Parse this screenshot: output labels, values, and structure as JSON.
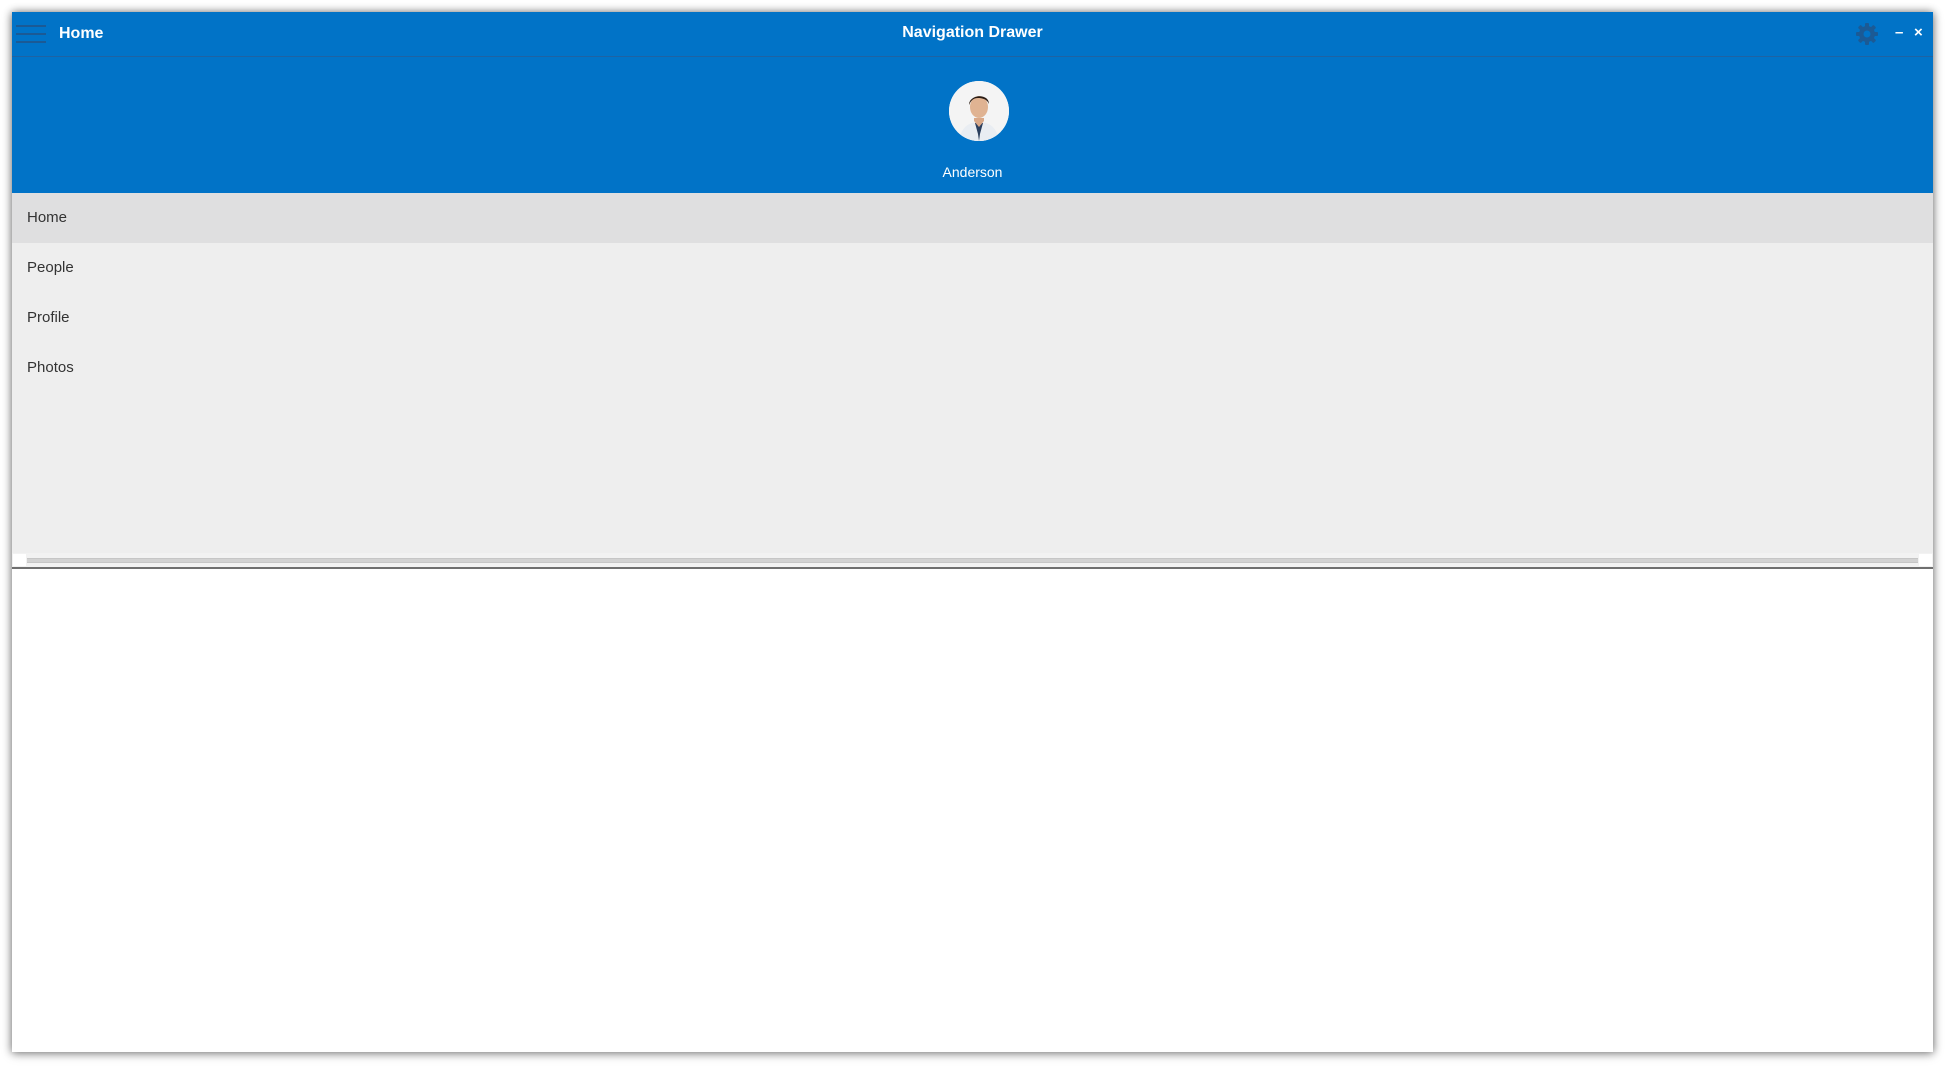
{
  "window": {
    "page_title": "Home",
    "app_title": "Navigation Drawer",
    "minimize_label": "–",
    "close_label": "×",
    "icons": {
      "menu": "hamburger-icon",
      "settings": "gear-icon"
    },
    "accent_color": "#0173c7"
  },
  "drawer": {
    "user_name": "Anderson",
    "menu_items": [
      {
        "label": "Home",
        "selected": true
      },
      {
        "label": "People",
        "selected": false
      },
      {
        "label": "Profile",
        "selected": false
      },
      {
        "label": "Photos",
        "selected": false
      }
    ]
  }
}
